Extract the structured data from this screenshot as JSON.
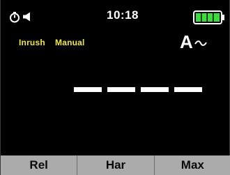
{
  "status": {
    "clock": "10:18",
    "icons": [
      "timer-icon",
      "speaker-icon",
      "battery-icon"
    ],
    "battery_level": 1.0,
    "battery_color": "#3ddc3d"
  },
  "modes": {
    "inrush": "Inrush",
    "manual": "Manual",
    "color": "#f2e84a"
  },
  "unit": {
    "symbol": "A",
    "ac_icon": "ac-wave-icon"
  },
  "reading": {
    "display": "----"
  },
  "softkeys": [
    {
      "label": "Rel"
    },
    {
      "label": "Har"
    },
    {
      "label": "Max"
    }
  ]
}
